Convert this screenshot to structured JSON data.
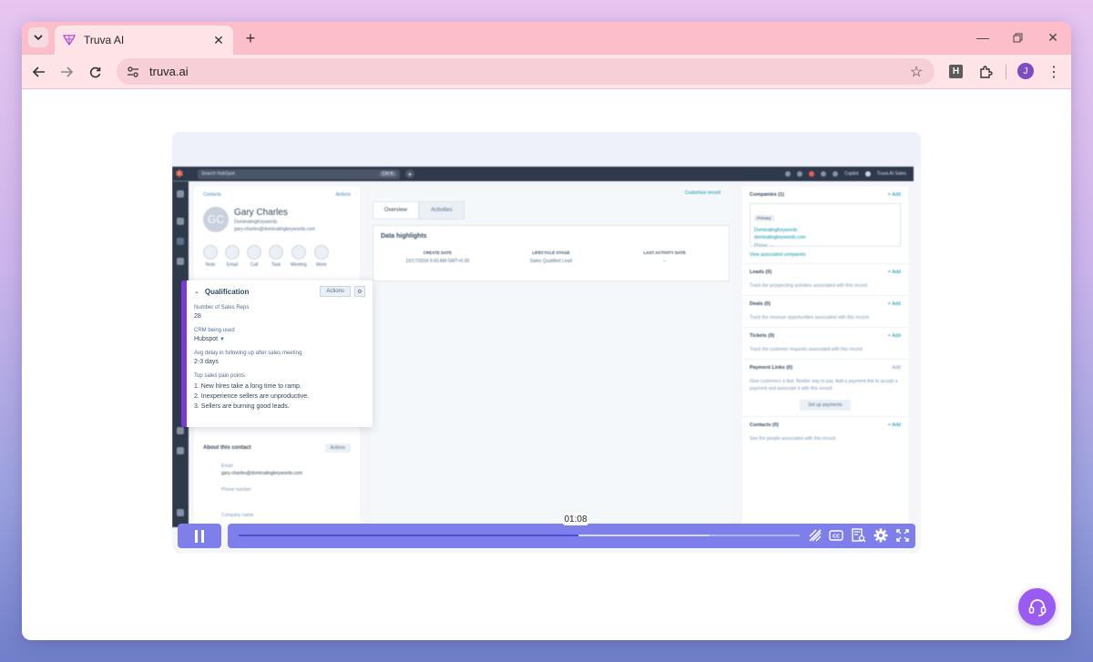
{
  "browser": {
    "tab_title": "Truva AI",
    "url": "truva.ai",
    "profile_initial": "J",
    "extension_letter": "H"
  },
  "hubspot": {
    "search_placeholder": "Search HubSpot",
    "search_shortcut": "Ctrl K",
    "copilot_label": "Copilot",
    "account_label": "Truva AI Sales",
    "back_link": "Contacts",
    "actions_label": "Actions",
    "contact": {
      "initials": "GC",
      "name": "Gary Charles",
      "company": "DominatingKeywords",
      "email": "gary-charles@dominatingkeywords.com"
    },
    "quick_actions": [
      "Note",
      "Email",
      "Call",
      "Task",
      "Meeting",
      "More"
    ],
    "tabs": [
      "Overview",
      "Activities"
    ],
    "customize_label": "Customize record",
    "highlights": {
      "title": "Data highlights",
      "columns": [
        {
          "header": "CREATE DATE",
          "value": "10/17/2024 9:43 AM GMT+5:30"
        },
        {
          "header": "LIFECYCLE STAGE",
          "value": "Sales Qualified Lead"
        },
        {
          "header": "LAST ACTIVITY DATE",
          "value": "--"
        }
      ]
    },
    "about": {
      "title": "About this contact",
      "actions_label": "Actions",
      "email_label": "Email",
      "email_value": "gary-charles@dominatingkeywords.com",
      "phone_label": "Phone number",
      "company_label": "Company name"
    },
    "qualification": {
      "title": "Qualification",
      "actions_label": "Actions",
      "fields": [
        {
          "label": "Number of Sales Reps",
          "value": "28"
        },
        {
          "label": "CRM being used",
          "value": "Hubspot"
        },
        {
          "label": "Avg delay in following up after sales meeting",
          "value": "2-3 days"
        }
      ],
      "pain_points_label": "Top sales pain points",
      "pain_points": [
        "1. New hires take a long time to ramp.",
        "2. Inexperience sellers are unproductive.",
        "3. Sellers are burning good leads."
      ]
    },
    "right_panel": {
      "companies": {
        "title": "Companies (1)",
        "add": "+ Add",
        "primary": "Primary",
        "name": "DominatingKeywords",
        "domain": "dominatingkeywords.com",
        "phone": "Phone: --",
        "view_link": "View associated companies"
      },
      "sections": [
        {
          "title": "Leads (0)",
          "add": "+ Add",
          "text": "Track the prospecting activities associated with this record."
        },
        {
          "title": "Deals (0)",
          "add": "+ Add",
          "text": "Track the revenue opportunities associated with this record."
        },
        {
          "title": "Tickets (0)",
          "add": "+ Add",
          "text": "Track the customer requests associated with this record."
        }
      ],
      "payment": {
        "title": "Payment Links (0)",
        "add": "Add",
        "text": "Give customers a fast, flexible way to pay. Add a payment link to accept a payment and associate it with this record.",
        "button": "Set up payments"
      },
      "contacts": {
        "title": "Contacts (0)",
        "add": "+ Add",
        "text": "See the people associated with this record."
      }
    }
  },
  "player": {
    "time_tooltip": "01:08",
    "progress_fraction": 0.605,
    "buffered_fraction": 0.84
  },
  "colors": {
    "player_accent": "#7e7fea",
    "support_button": "#9a5cf0",
    "qualification_accent": "#7b39d8"
  }
}
